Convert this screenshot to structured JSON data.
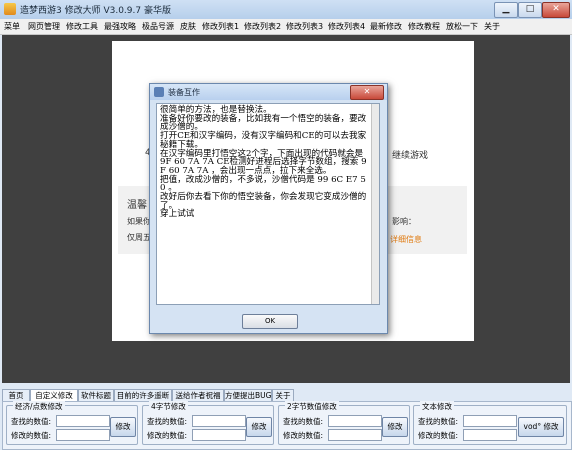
{
  "app": {
    "title": "造梦西游3 修改大师 V3.0.9.7 豪华版"
  },
  "window_controls": {
    "minimize": "▁",
    "maximize": "□",
    "close": "✕"
  },
  "menu": [
    "菜单",
    "网页管理",
    "修改工具",
    "最强攻略",
    "极品号源",
    "皮肤",
    "修改列表1",
    "修改列表2",
    "修改列表3",
    "修改列表4",
    "最新修改",
    "修改教程",
    "放松一下",
    "关于"
  ],
  "background": {
    "line1_left": "4",
    "line1_right": "继续游戏",
    "tip_title": "温馨",
    "tip_line1": "如果你",
    "tip_line1_right": "影响：",
    "tip_line2": "仅周五",
    "detail_link": "详细信息"
  },
  "dialog": {
    "title": "装备互作",
    "close": "✕",
    "text": "很简单的方法，也是替换法。\n准备好你要改的装备，比如我有一个悟空的装备，要改成沙僧的。\n打开CE和汉字编码，没有汉字编码和CE的可以去我家秘籍下载。\n在汉字编码里打悟空这2个字，下面出现的代码就会是 9F 60 7A 7A CE检测好进程后选择字节数组，搜索 9F 60 7A 7A ，会出现一点点，拉下来全选。\n把值，改成沙僧的，不多说，沙僧代码是 99 6C E7 50 。\n改好后你去看下你的悟空装备，你会发现它变成沙僧的了。\n穿上试试",
    "ok": "OK"
  },
  "tabs": [
    "首页",
    "自定义修改",
    "软件标题",
    "目前的许多遥断",
    "送给作者祝福",
    "方便提出BUG",
    "关于"
  ],
  "active_tab": 1,
  "groups": [
    {
      "title": "经济/点数修改",
      "row1": "查找的数值:",
      "row2": "修改的数值:",
      "button": "修改"
    },
    {
      "title": "4字节修改",
      "row1": "查找的数值:",
      "row2": "修改的数值:",
      "button": "修改"
    },
    {
      "title": "2字节数值修改",
      "row1": "查找的数值:",
      "row2": "修改的数值:",
      "button": "修改"
    },
    {
      "title": "文本修改",
      "row1": "查找的数值:",
      "row2": "修改的数值:",
      "button": "vod° 修改"
    }
  ]
}
